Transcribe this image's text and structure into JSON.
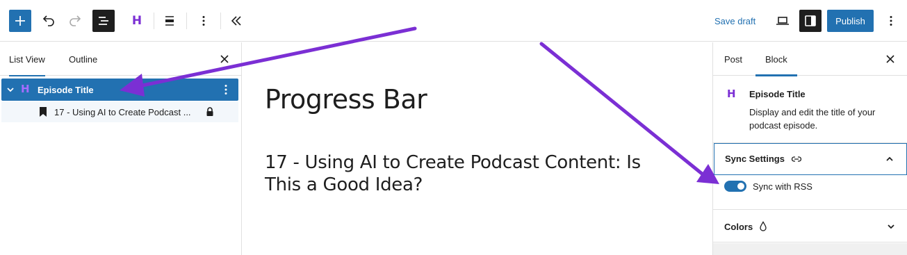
{
  "toolbar": {
    "add_icon": "plus-icon",
    "undo_icon": "undo-icon",
    "redo_icon": "redo-icon",
    "list_view_icon": "list-view-icon",
    "block_type_icon": "heading-h-icon",
    "block_type_glyph": "H",
    "align_icon": "align-icon",
    "more_icon": "vertical-ellipsis-icon",
    "collapse_icon": "double-chevron-left-icon",
    "save_draft_label": "Save draft",
    "preview_icon": "laptop-icon",
    "settings_icon": "sidebar-settings-icon",
    "publish_label": "Publish",
    "options_icon": "vertical-ellipsis-icon",
    "accent_color": "#2271b1"
  },
  "left_panel": {
    "tabs": [
      {
        "label": "List View",
        "active": true
      },
      {
        "label": "Outline",
        "active": false
      }
    ],
    "close_icon": "close-icon",
    "items": [
      {
        "label": "Episode Title",
        "icon": "heading-h-icon",
        "glyph": "H",
        "selected": true
      },
      {
        "label": "17 - Using AI to Create Podcast ...",
        "icon": "bookmark-icon",
        "lock_icon": "lock-icon",
        "selected": false
      }
    ]
  },
  "canvas": {
    "post_title": "Progress Bar",
    "episode_title": "17 - Using AI to Create Podcast Content: Is This a Good Idea?"
  },
  "right_panel": {
    "tabs": [
      {
        "label": "Post",
        "active": false
      },
      {
        "label": "Block",
        "active": true
      }
    ],
    "close_icon": "close-icon",
    "block": {
      "icon_glyph": "H",
      "name": "Episode Title",
      "description": "Display and edit the title of your podcast episode."
    },
    "sync_settings": {
      "title": "Sync Settings",
      "link_icon": "link-icon",
      "expanded": true,
      "toggle_label": "Sync with RSS",
      "toggle_on": true
    },
    "colors": {
      "title": "Colors",
      "icon": "drop-icon",
      "expanded": false
    }
  },
  "annotations": {
    "arrow_color": "#7b2fd4"
  }
}
